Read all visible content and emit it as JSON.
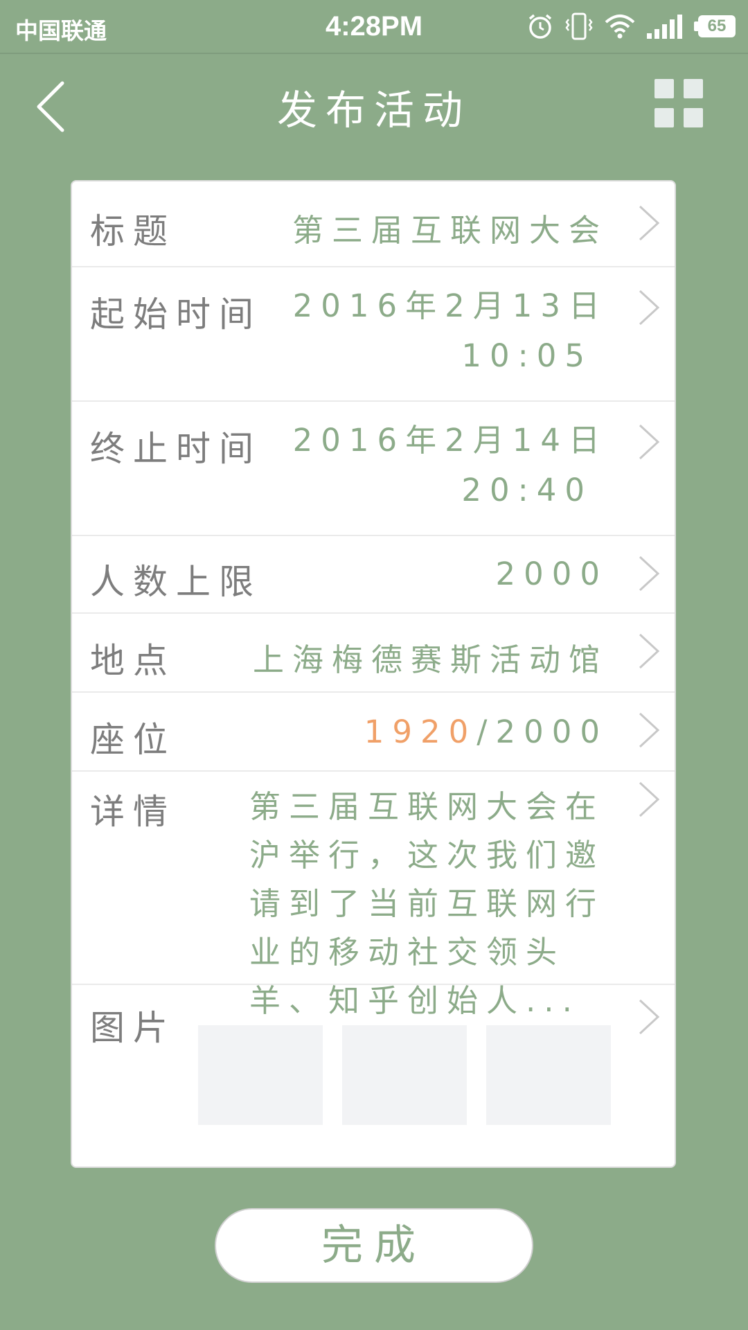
{
  "status_bar": {
    "carrier": "中国联通",
    "time": "4:28PM",
    "battery": "65",
    "icons": [
      "alarm-icon",
      "vibrate-icon",
      "wifi-icon",
      "signal-icon",
      "battery-icon"
    ]
  },
  "nav": {
    "title": "发布活动",
    "back_icon": "back-chevron-icon",
    "menu_icon": "grid-menu-icon"
  },
  "form": {
    "title": {
      "label": "标题",
      "value": "第三届互联网大会"
    },
    "start_time": {
      "label": "起始时间",
      "date": "2016年2月13日",
      "time": "10:05"
    },
    "end_time": {
      "label": "终止时间",
      "date": "2016年2月14日",
      "time": "20:40"
    },
    "capacity": {
      "label": "人数上限",
      "value": "2000"
    },
    "location": {
      "label": "地点",
      "value": "上海梅德赛斯活动馆"
    },
    "seats": {
      "label": "座位",
      "taken": "1920",
      "separator": "/",
      "total": "2000"
    },
    "details": {
      "label": "详情",
      "value": "第三届互联网大会在沪举行，这次我们邀请到了当前互联网行业的移动社交领头羊、知乎创始人..."
    },
    "pictures": {
      "label": "图片"
    }
  },
  "done_button": "完成",
  "colors": {
    "background": "#8cab89",
    "accent": "#8cab89",
    "highlight": "#f0a068",
    "label": "#7d7d7d"
  }
}
